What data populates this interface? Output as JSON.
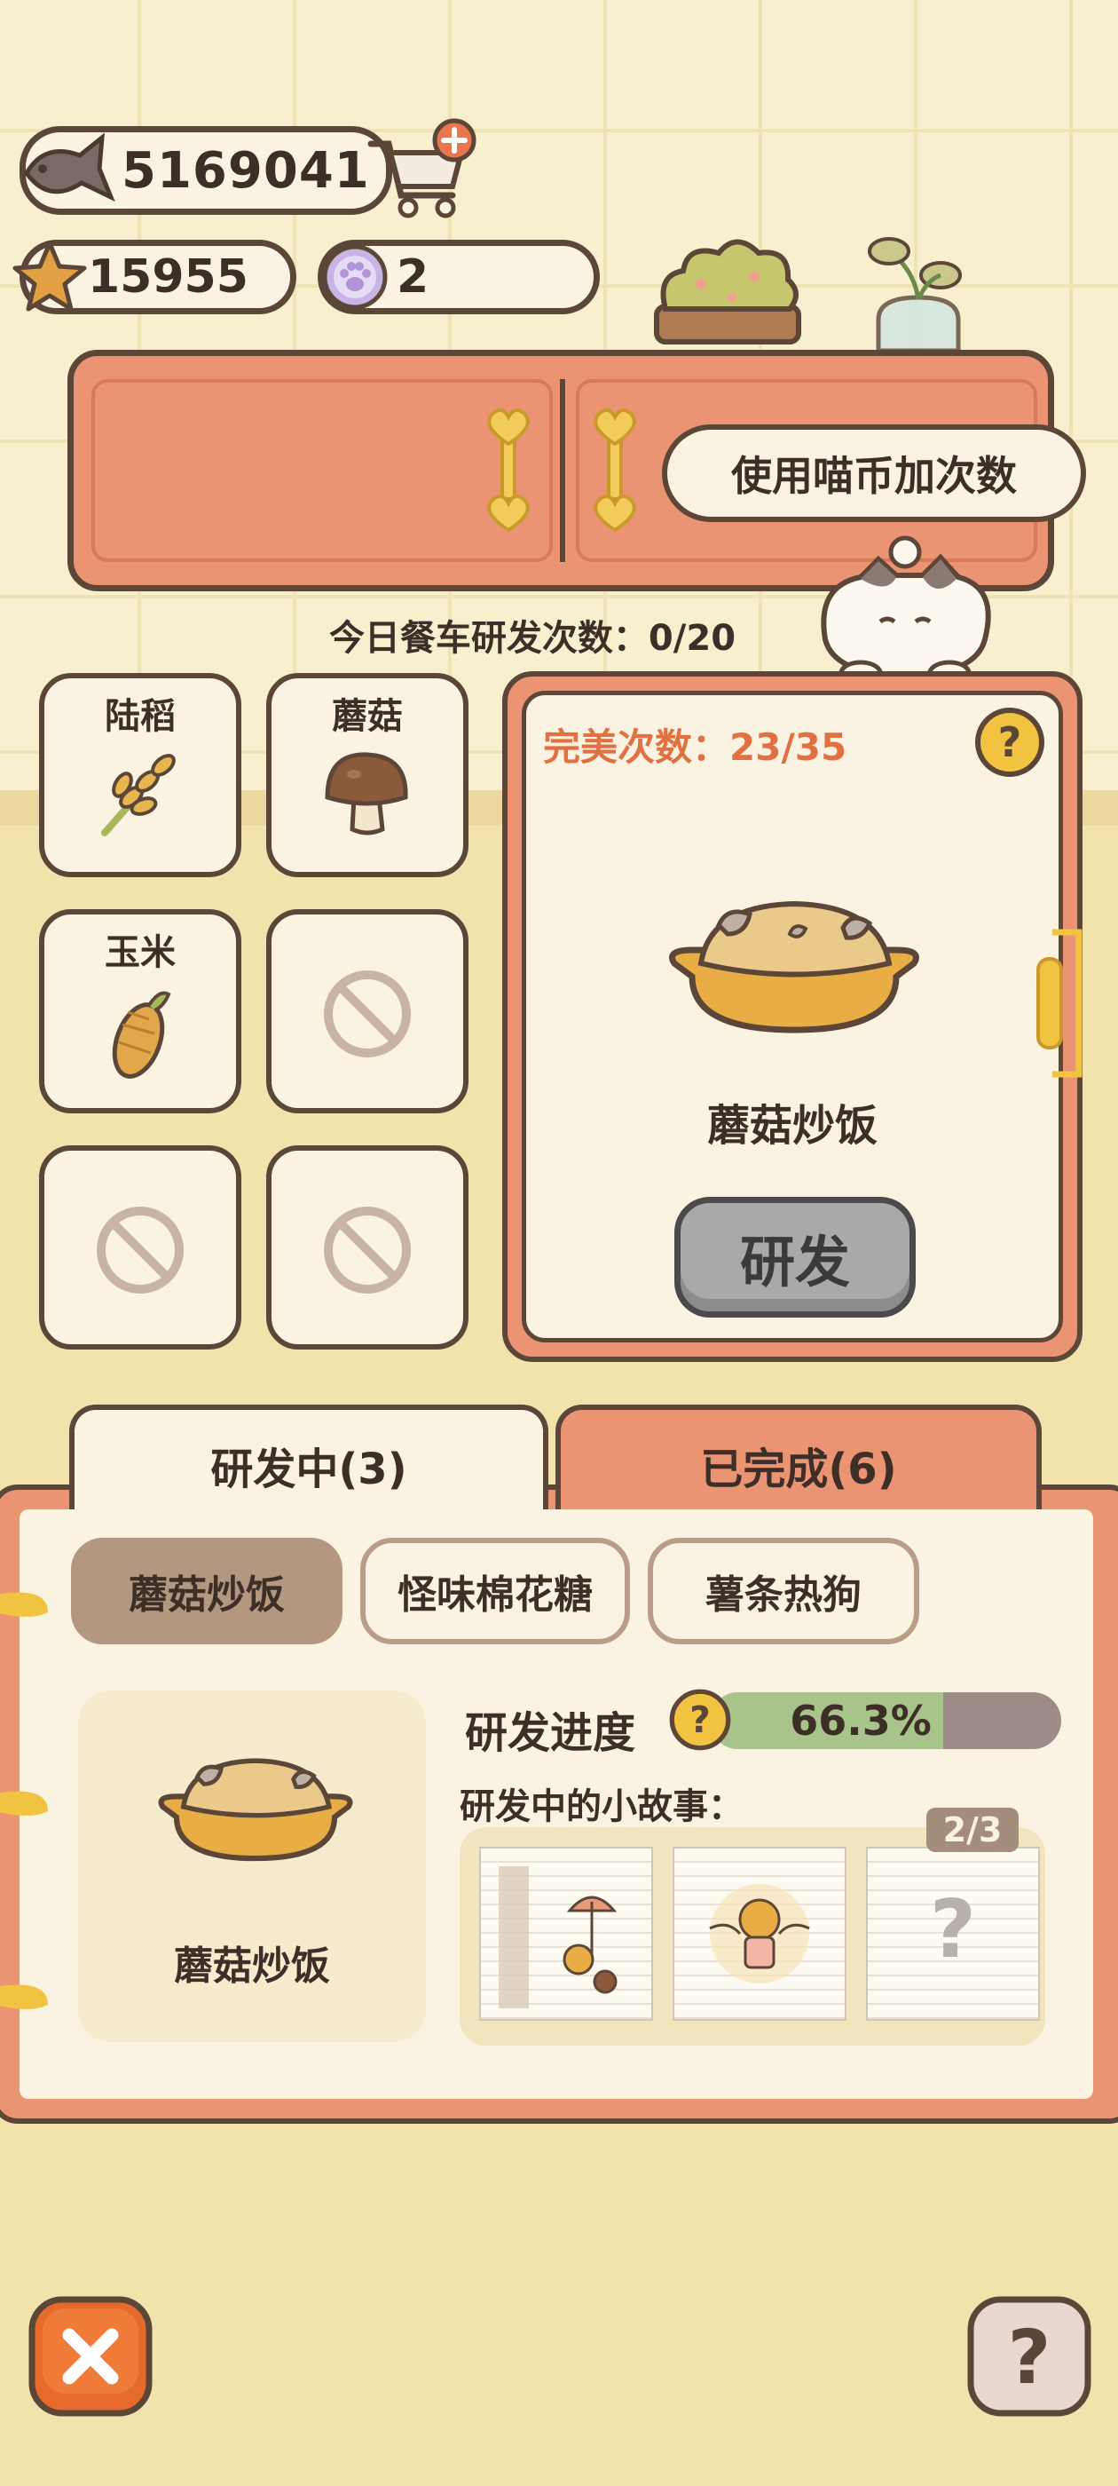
{
  "currency": {
    "coins": "5169041",
    "stars": "15955",
    "paws": "2"
  },
  "bubble_text": "使用喵币加次数",
  "daily_research": "今日餐车研发次数：0/20",
  "ingredients": [
    {
      "label": "陆稻",
      "icon": "rice-icon"
    },
    {
      "label": "蘑菇",
      "icon": "mushroom-icon"
    },
    {
      "label": "玉米",
      "icon": "corn-icon"
    },
    {
      "label": "",
      "icon": "disabled-icon"
    },
    {
      "label": "",
      "icon": "disabled-icon"
    },
    {
      "label": "",
      "icon": "disabled-icon"
    }
  ],
  "panel": {
    "perfect_count": "完美次数：23/35",
    "dish_name": "蘑菇炒饭",
    "research_button": "研发"
  },
  "tabs": {
    "in_progress": "研发中(3)",
    "completed": "已完成(6)"
  },
  "recipes": [
    "蘑菇炒饭",
    "怪味棉花糖",
    "薯条热狗"
  ],
  "progress": {
    "label": "研发进度",
    "value": "66.3%",
    "fraction": 0.663
  },
  "story": {
    "label": "研发中的小故事：",
    "count": "2/3"
  },
  "selected_dish_name": "蘑菇炒饭",
  "colors": {
    "accent": "#eb9473",
    "outline": "#5b4638",
    "cream": "#fbf3e2",
    "progress_fill": "#a8c48a",
    "perfect_text": "#e17143"
  }
}
